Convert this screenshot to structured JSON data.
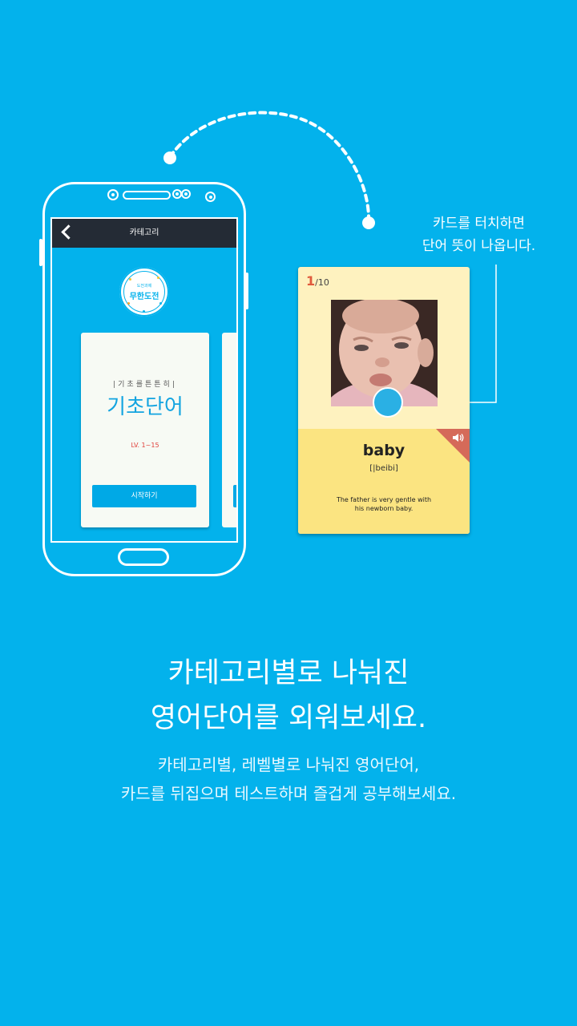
{
  "app_screen": {
    "title": "카테고리",
    "badge_small": "도전과제",
    "badge_main": "무한도전",
    "category_card": {
      "subtitle": "|기초를튼튼히|",
      "title": "기초단어",
      "level": "LV. 1~15",
      "start_label": "시작하기"
    }
  },
  "flash_card": {
    "index": "1",
    "total": "/10",
    "word": "baby",
    "phonetic": "[|beibi]",
    "example_line1": "The father is very gentle with",
    "example_line2": "his newborn baby."
  },
  "hint": {
    "line1": "카드를 터치하면",
    "line2": "단어 뜻이 나옵니다."
  },
  "headline": {
    "line1": "카테고리별로 나눠진",
    "line2": "영어단어를 외워보세요."
  },
  "subline": {
    "line1": "카테고리별, 레벨별로 나눠진 영어단어,",
    "line2": "카드를 뒤집으며 테스트하며 즐겁게 공부해보세요."
  },
  "colors": {
    "background": "#03b2ec",
    "appbar": "#242b35",
    "accent": "#00a9e6",
    "card_top": "#fef2bf",
    "card_bottom": "#fbe481",
    "level_red": "#e0403a"
  }
}
